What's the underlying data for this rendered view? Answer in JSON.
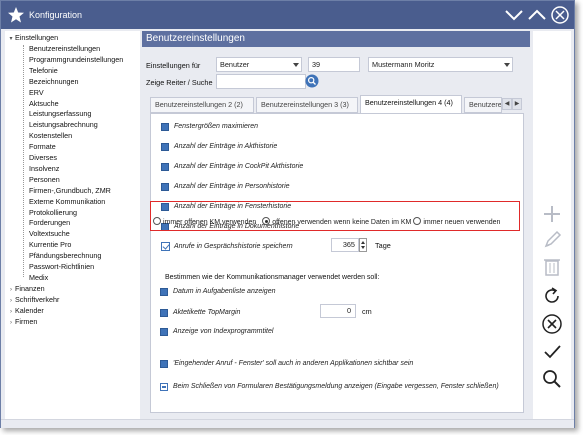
{
  "window": {
    "title": "Konfiguration"
  },
  "tree": {
    "root_label": "Einstellungen",
    "children": [
      "Benutzereinstellungen",
      "Programmgrundeinstellungen",
      "Telefonie",
      "Bezeichnungen",
      "ERV",
      "Aktsuche",
      "Leistungserfassung",
      "Leistungsabrechnung",
      "Kostenstellen",
      "Formate",
      "Diverses",
      "Insolvenz",
      "Personen",
      "Firmen-,Grundbuch, ZMR",
      "Externe Kommunikation",
      "Protokollierung",
      "Forderungen",
      "Voltextsuche",
      "Kurrentie Pro",
      "Pfändungsberechnung",
      "Passwort-Richtlinien",
      "Medix"
    ],
    "others": [
      "Finanzen",
      "Schriftverkehr",
      "Kalender",
      "Firmen"
    ]
  },
  "page": {
    "header": "Benutzereinstellungen",
    "settings_for_label": "Einstellungen für",
    "settings_for_value": "Benutzer",
    "user_id": "39",
    "user_name": "Mustermann Moritz",
    "search_label": "Zeige Reiter / Suche",
    "search_value": ""
  },
  "tabs": [
    {
      "label": "Benutzereinstellungen 2 (2)"
    },
    {
      "label": "Benutzereinstellungen 3 (3)"
    },
    {
      "label": "Benutzereinstellungen 4 (4)"
    },
    {
      "label": "Benutzere"
    }
  ],
  "options": {
    "maximize": "Fenstergrößen maximieren",
    "akthistorie": "Anzahl der Einträge in Akthistorie",
    "cockpit": "Anzahl der Einträge in CockPit Akthistorie",
    "personhistorie": "Anzahl der Einträge in Personhistorie",
    "fensterhistorie": "Anzahl der Einträge in Fensterhistorie",
    "dokumenthistorie": "Anzahl der Einträge in Dokumenthistorie",
    "anrufe": "Anrufe in Gesprächshistorie speichern",
    "anrufe_value": "365",
    "anrufe_unit": "Tage",
    "km_question": "Bestimmen wie der Kommunikationsmanager verwendet werden soll:",
    "km_opt1": "immer offenen KM verwenden",
    "km_opt2": "offenen verwenden wenn keine Daten im KM",
    "km_opt3": "immer neuen verwenden",
    "datum": "Datum in Aufgabenliste anzeigen",
    "topmargin": "Aktetikette TopMargin",
    "topmargin_value": "0",
    "topmargin_unit": "cm",
    "indexprog": "Anzeige von Indexprogrammtitel",
    "eingehend": "'Eingehender Anruf - Fenster' soll auch in anderen Applikationen sichtbar sein",
    "schliessen": "Beim Schließen von Formularen Bestätigungsmeldung anzeigen (Eingabe vergessen, Fenster schließen)"
  },
  "colors": {
    "titlebar": "#4a5d8e",
    "header": "#5e70a0",
    "accent": "#3f73b8",
    "highlight": "#e02a2a"
  }
}
